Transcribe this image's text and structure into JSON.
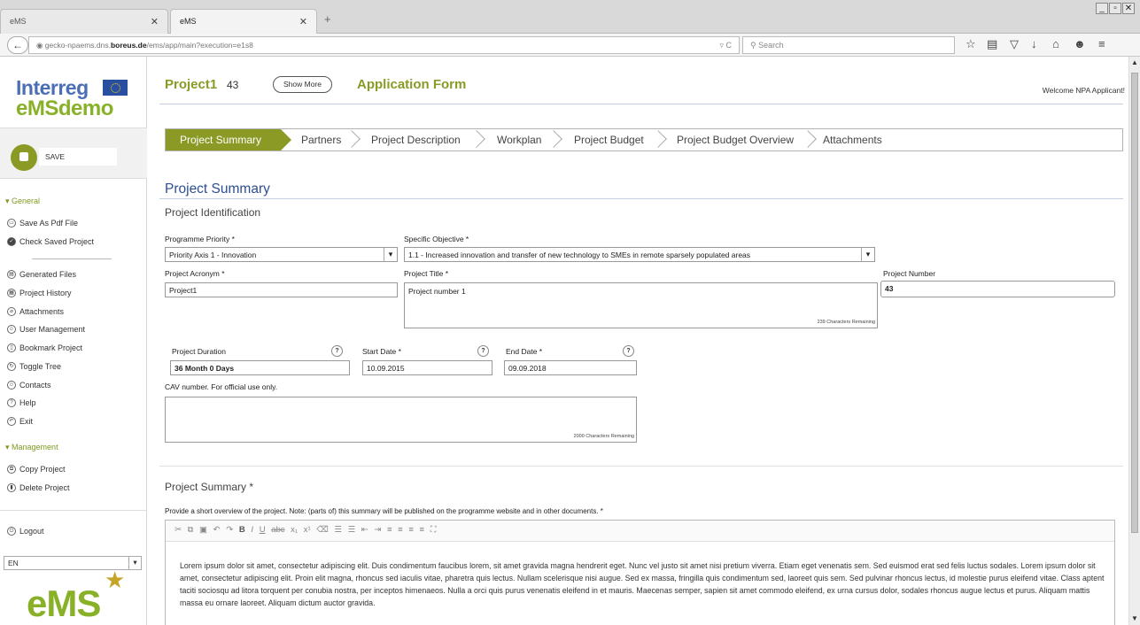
{
  "browser": {
    "tabs": [
      {
        "label": "eMS"
      },
      {
        "label": "eMS"
      }
    ],
    "new_tab": "+",
    "url_prefix": "gecko-npaems.dns.",
    "url_domain": "boreus.de",
    "url_path": "/ems/app/main?execution=e1s8",
    "search_placeholder": "Search",
    "window_buttons": [
      "_",
      "▫",
      "✕"
    ]
  },
  "sidebar": {
    "logo_top": "Interreg",
    "logo_bottom_left": "eMS",
    "logo_bottom_right": "demo",
    "save_label": "SAVE",
    "group_general": "General",
    "general_items": [
      "Save As Pdf File",
      "Check Saved Project"
    ],
    "tools_items": [
      "Generated Files",
      "Project History",
      "Attachments",
      "User Management",
      "Bookmark Project",
      "Toggle Tree",
      "Contacts",
      "Help",
      "Exit"
    ],
    "group_management": "Management",
    "management_items": [
      "Copy Project",
      "Delete Project"
    ],
    "logout_label": "Logout",
    "language": "EN",
    "footer_logo": "eMS"
  },
  "header": {
    "project_name": "Project1",
    "project_number": "43",
    "show_more": "Show More",
    "application_form": "Application Form",
    "welcome": "Welcome NPA Applicant!"
  },
  "steps": [
    "Project Summary",
    "Partners",
    "Project Description",
    "Workplan",
    "Project Budget",
    "Project Budget Overview",
    "Attachments"
  ],
  "active_step": "Project Summary",
  "form": {
    "section_title": "Project Summary",
    "subsection": "Project Identification",
    "programme_priority_label": "Programme Priority *",
    "programme_priority_value": "Priority Axis 1 - Innovation",
    "specific_objective_label": "Specific Objective *",
    "specific_objective_value": "1.1 - Increased innovation and transfer of new technology to SMEs in remote sparsely populated areas",
    "acronym_label": "Project Acronym *",
    "acronym_value": "Project1",
    "title_label": "Project Title *",
    "title_value": "Project number 1",
    "title_remaining": "239 Characters Remaining",
    "number_label": "Project Number",
    "number_value": "43",
    "duration_label": "Project Duration",
    "duration_value": "36 Month 0 Days",
    "start_label": "Start Date *",
    "start_value": "10.09.2015",
    "end_label": "End Date *",
    "end_value": "09.09.2018",
    "help_glyph": "?",
    "cav_label": "CAV number. For official use only.",
    "cav_remaining": "2000 Characters Remaining",
    "summary_title": "Project Summary *",
    "summary_hint": "Provide a short overview of the project. Note: (parts of) this summary will be published on the programme website and in other documents.  *",
    "summary_text": "Lorem ipsum dolor sit amet, consectetur adipiscing elit. Duis condimentum faucibus lorem, sit amet gravida magna hendrerit eget. Nunc vel justo sit amet nisi pretium viverra. Etiam eget venenatis sem. Sed euismod erat sed felis luctus sodales. Lorem ipsum dolor sit amet, consectetur adipiscing elit. Proin elit magna, rhoncus sed iaculis vitae, pharetra quis lectus. Nullam scelerisque nisi augue. Sed ex massa, fringilla quis condimentum sed, laoreet quis sem. Sed pulvinar rhoncus lectus, id molestie purus eleifend vitae. Class aptent taciti sociosqu ad litora torquent per conubia nostra, per inceptos himenaeos. Nulla a orci quis purus venenatis eleifend in et mauris. Maecenas semper, sapien sit amet commodo eleifend, ex urna cursus dolor, sodales rhoncus augue lectus et purus. Aliquam mattis massa eu ornare laoreet. Aliquam dictum auctor gravida."
  },
  "colors": {
    "accent": "#8a9a25",
    "heading": "#2c4e94",
    "group": "#7d9a1e"
  }
}
